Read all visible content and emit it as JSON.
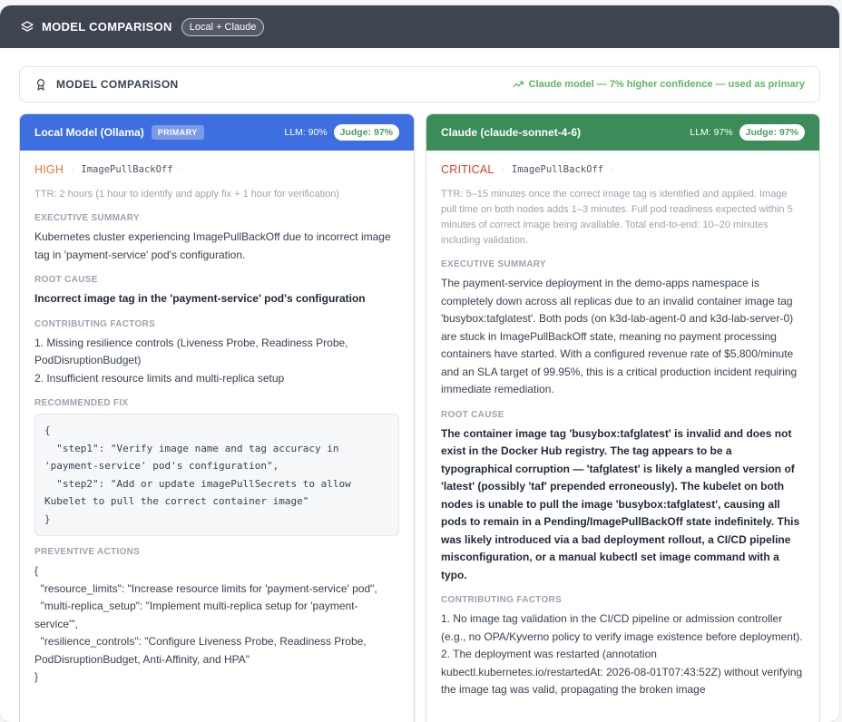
{
  "header": {
    "title": "MODEL COMPARISON",
    "pill": "Local + Claude"
  },
  "summary": {
    "title": "MODEL COMPARISON",
    "note": "Claude model — 7% higher confidence — used as primary"
  },
  "left": {
    "name": "Local Model (Ollama)",
    "badge": "PRIMARY",
    "llm": "LLM: 90%",
    "judge": "Judge: 97%",
    "severity": "HIGH",
    "code": "ImagePullBackOff",
    "ttr": "TTR: 2 hours (1 hour to identify and apply fix + 1 hour for verification)",
    "exec_label": "EXECUTIVE SUMMARY",
    "exec": "Kubernetes cluster experiencing ImagePullBackOff due to incorrect image tag in 'payment-service' pod's configuration.",
    "root_label": "ROOT CAUSE",
    "root": "Incorrect image tag in the 'payment-service' pod's configuration",
    "contrib_label": "CONTRIBUTING FACTORS",
    "contrib": "1. Missing resilience controls (Liveness Probe, Readiness Probe, PodDisruptionBudget)\n2. Insufficient resource limits and multi-replica setup",
    "fix_label": "RECOMMENDED FIX",
    "fix": "{\n  \"step1\": \"Verify image name and tag accuracy in 'payment-service' pod's configuration\",\n  \"step2\": \"Add or update imagePullSecrets to allow Kubelet to pull the correct container image\"\n}",
    "prev_label": "PREVENTIVE ACTIONS",
    "prev": "{\n  \"resource_limits\": \"Increase resource limits for 'payment-service' pod\",\n  \"multi-replica_setup\": \"Implement multi-replica setup for 'payment-service'\",\n  \"resilience_controls\": \"Configure Liveness Probe, Readiness Probe, PodDisruptionBudget, Anti-Affinity, and HPA\"\n}"
  },
  "right": {
    "name": "Claude (claude-sonnet-4-6)",
    "llm": "LLM: 97%",
    "judge": "Judge: 97%",
    "severity": "CRITICAL",
    "code": "ImagePullBackOff",
    "ttr": "TTR: 5–15 minutes once the correct image tag is identified and applied. Image pull time on both nodes adds 1–3 minutes. Full pod readiness expected within 5 minutes of correct image being available. Total end-to-end: 10–20 minutes including validation.",
    "exec_label": "EXECUTIVE SUMMARY",
    "exec": "The payment-service deployment in the demo-apps namespace is completely down across all replicas due to an invalid container image tag 'busybox:tafglatest'. Both pods (on k3d-lab-agent-0 and k3d-lab-server-0) are stuck in ImagePullBackOff state, meaning no payment processing containers have started. With a configured revenue rate of $5,800/minute and an SLA target of 99.95%, this is a critical production incident requiring immediate remediation.",
    "root_label": "ROOT CAUSE",
    "root": "The container image tag 'busybox:tafglatest' is invalid and does not exist in the Docker Hub registry. The tag appears to be a typographical corruption — 'tafglatest' is likely a mangled version of 'latest' (possibly 'taf' prepended erroneously). The kubelet on both nodes is unable to pull the image 'busybox:tafglatest', causing all pods to remain in a Pending/ImagePullBackOff state indefinitely. This was likely introduced via a bad deployment rollout, a CI/CD pipeline misconfiguration, or a manual kubectl set image command with a typo.",
    "contrib_label": "CONTRIBUTING FACTORS",
    "contrib": "1. No image tag validation in the CI/CD pipeline or admission controller (e.g., no OPA/Kyverno policy to verify image existence before deployment). 2. The deployment was restarted (annotation kubectl.kubernetes.io/restartedAt: 2026-08-01T07:43:52Z) without verifying the image tag was valid, propagating the broken image"
  },
  "icons": {
    "header": "layers-icon",
    "summary": "award-icon",
    "note": "trending-up-icon"
  },
  "colors": {
    "topbar": "#3f4451",
    "local": "#3e6fe0",
    "claude": "#3c8c5a",
    "high": "#e07b2c",
    "critical": "#d64030",
    "note": "#5cb85c"
  }
}
